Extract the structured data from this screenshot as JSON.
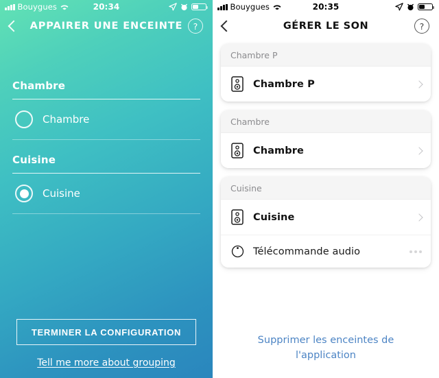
{
  "left": {
    "status_bar": {
      "signal_icon": "signal-bars-icon",
      "carrier": "Bouygues",
      "wifi_icon": "wifi-icon",
      "time": "20:34",
      "location_icon": "location-arrow-icon",
      "alarm_icon": "alarm-clock-icon",
      "battery_icon": "battery-icon"
    },
    "nav": {
      "back_icon": "back-chevron-icon",
      "title": "APPAIRER UNE ENCEINTE",
      "help_icon": "help-question-icon",
      "help_label": "?"
    },
    "groups": [
      {
        "title": "Chambre",
        "options": [
          {
            "label": "Chambre",
            "selected": false
          }
        ]
      },
      {
        "title": "Cuisine",
        "options": [
          {
            "label": "Cuisine",
            "selected": true
          }
        ]
      }
    ],
    "finish_button": "TERMINER LA CONFIGURATION",
    "more_link": "Tell me more about grouping",
    "gradient_start": "#62e2b4",
    "gradient_end": "#2a86bd"
  },
  "right": {
    "status_bar": {
      "signal_icon": "signal-bars-icon",
      "carrier": "Bouygues",
      "wifi_icon": "wifi-icon",
      "time": "20:35",
      "location_icon": "location-arrow-icon",
      "alarm_icon": "alarm-clock-icon",
      "battery_icon": "battery-icon"
    },
    "nav": {
      "back_icon": "back-chevron-icon",
      "title": "GÉRER LE SON",
      "help_icon": "help-question-icon",
      "help_label": "?"
    },
    "cards": [
      {
        "header": "Chambre P",
        "rows": [
          {
            "icon": "speaker-icon",
            "label": "Chambre P",
            "accessory": "chevron-right-icon"
          }
        ]
      },
      {
        "header": "Chambre",
        "rows": [
          {
            "icon": "speaker-icon",
            "label": "Chambre",
            "accessory": "chevron-right-icon"
          }
        ]
      },
      {
        "header": "Cuisine",
        "rows": [
          {
            "icon": "speaker-icon",
            "label": "Cuisine",
            "accessory": "chevron-right-icon"
          },
          {
            "icon": "remote-control-icon",
            "label": "Télécommande audio",
            "accessory": "more-dots-icon"
          }
        ]
      }
    ],
    "delete_link": "Supprimer les enceintes de l'application",
    "link_color": "#4c84c4"
  }
}
